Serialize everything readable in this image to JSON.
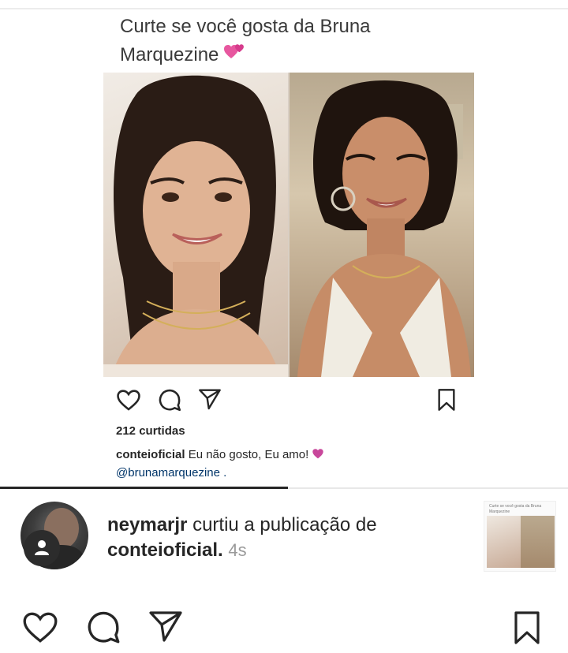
{
  "inner_post": {
    "caption_line1": "Curte se você gosta da Bruna",
    "caption_line2": "Marquezine",
    "caption_emoji": "💕",
    "likes": "212 curtidas",
    "caption_user": "conteioficial",
    "caption_text": "Eu não gosto, Eu amo!",
    "caption_emoji2": "💜",
    "mention": "@brunamarquezine ."
  },
  "notification": {
    "user": "neymarjr",
    "action": "curtiu a publicação de",
    "target": "conteioficial.",
    "time": "4s",
    "thumb_caption": "Curte se você gosta da Bruna Marquezine"
  },
  "icons": {
    "like": "heart-icon",
    "comment": "comment-icon",
    "share": "send-icon",
    "save": "bookmark-icon"
  },
  "colors": {
    "text": "#262626",
    "mention": "#003569",
    "muted": "#9a9a9a",
    "heart_pink": "#c8479b"
  }
}
